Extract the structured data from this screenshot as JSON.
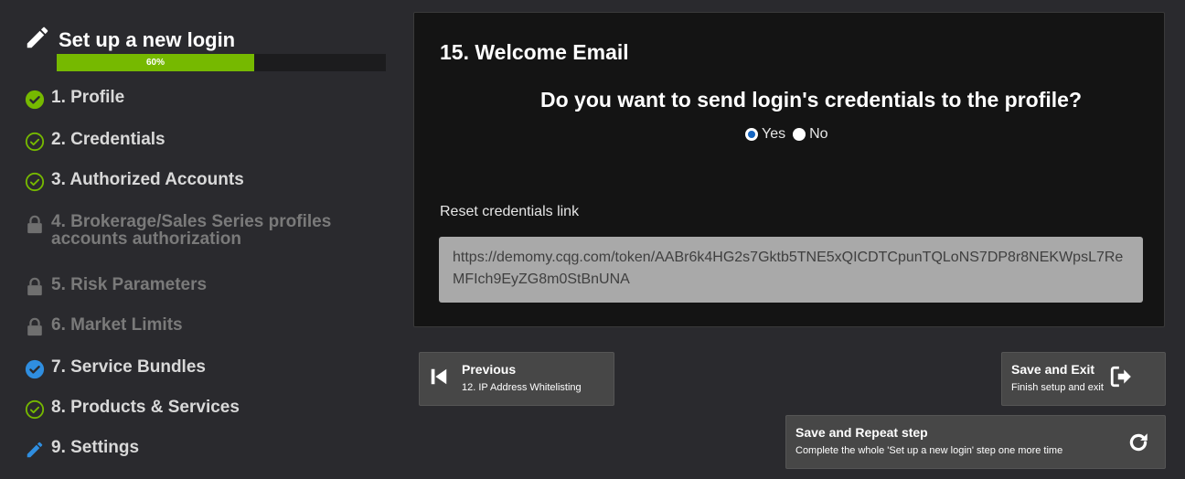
{
  "wizard": {
    "title": "Set up a new login",
    "progress_label": "60%",
    "progress_value": 0.6,
    "steps": [
      {
        "label": "1. Profile",
        "state": "complete-filled"
      },
      {
        "label": "2. Credentials",
        "state": "complete"
      },
      {
        "label": "3. Authorized Accounts",
        "state": "complete"
      },
      {
        "label": "4. Brokerage/Sales Series profiles",
        "label2": "accounts authorization",
        "state": "locked"
      },
      {
        "label": "5. Risk Parameters",
        "state": "locked"
      },
      {
        "label": "6. Market Limits",
        "state": "locked"
      },
      {
        "label": "7. Service Bundles",
        "state": "complete-blue"
      },
      {
        "label": "8. Products & Services",
        "state": "complete"
      },
      {
        "label": "9. Settings",
        "state": "editing"
      }
    ]
  },
  "panel": {
    "title": "15. Welcome Email",
    "question": "Do you want to send login's credentials to the profile?",
    "options": [
      {
        "label": "Yes",
        "selected": true
      },
      {
        "label": "No",
        "selected": false
      }
    ],
    "reset_label": "Reset credentials link",
    "reset_link": "https://demomy.cqg.com/token/AABr6k4HG2s7Gktb5TNE5xQICDTCpunTQLoNS7DP8r8NEKWpsL7ReMFIch9EyZG8m0StBnUNA"
  },
  "buttons": {
    "previous": {
      "title": "Previous",
      "subtitle": "12. IP Address Whitelisting"
    },
    "save_exit": {
      "title": "Save and Exit",
      "subtitle": "Finish setup and exit"
    },
    "save_repeat": {
      "title": "Save and Repeat step",
      "subtitle": "Complete the whole 'Set up a new login' step one more time"
    }
  },
  "colors": {
    "accent_green": "#76b900",
    "check_green": "#76b900",
    "blue": "#2f8ee0",
    "locked": "#6f6f6f",
    "background": "#2a2a2e",
    "panel": "#141414"
  }
}
